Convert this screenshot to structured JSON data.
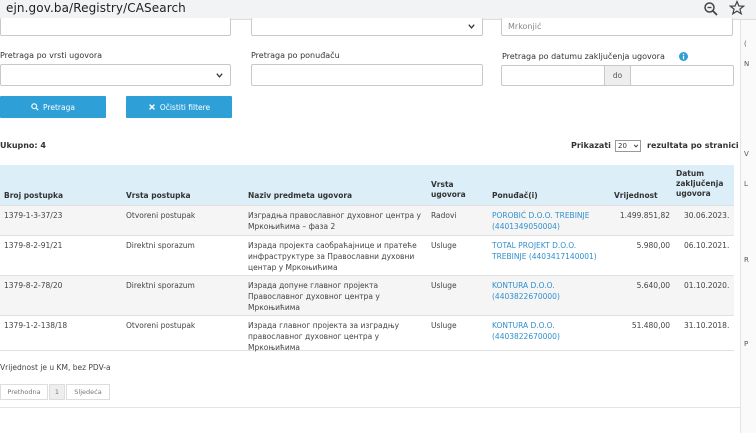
{
  "browser": {
    "url": "ejn.gov.ba/Registry/CASearch"
  },
  "filters": {
    "top_field_value": "Mrkonjić",
    "contract_type_label": "Pretraga po vrsti ugovora",
    "bidder_label": "Pretraga po ponuđaču",
    "date_label": "Pretraga po datumu zaključenja ugovora",
    "date_to_label": "do",
    "search_button": "Pretraga",
    "clear_button": "Očistiti filtere"
  },
  "results": {
    "total_label": "Ukupno: 4",
    "show_label": "Prikazati",
    "page_size": "20",
    "per_page_label": "rezultata po stranici"
  },
  "table": {
    "headers": {
      "number": "Broj postupka",
      "procedure_type": "Vrsta postupka",
      "subject": "Naziv predmeta ugovora",
      "contract_type": [
        "Vrsta",
        "ugovora"
      ],
      "bidder": "Ponuđač(i)",
      "value": "Vrijednost",
      "date": [
        "Datum",
        "zaključenja",
        "ugovora"
      ]
    },
    "rows": [
      {
        "number": "1379-1-3-37/23",
        "procedure_type": "Otvoreni postupak",
        "subject": [
          "Изградња православног духовног центра у",
          "Мркоњићима – фаза 2"
        ],
        "contract_type": "Radovi",
        "bidder": [
          "POROBIĆ D.O.O. TREBINJE",
          "(4401349050004)"
        ],
        "value": "1.499.851,82",
        "date": "30.06.2023."
      },
      {
        "number": "1379-8-2-91/21",
        "procedure_type": "Direktni sporazum",
        "subject": [
          "Израда пројекта саобраћајнице и прaтеће",
          "инфраструктуре за Православни духовни",
          "центар у Мркоњићима"
        ],
        "contract_type": "Usluge",
        "bidder": [
          "TOTAL PROJEKT D.O.O.",
          "TREBINJE (4403417140001)"
        ],
        "value": "5.980,00",
        "date": "06.10.2021."
      },
      {
        "number": "1379-8-2-78/20",
        "procedure_type": "Direktni sporazum",
        "subject": [
          "Израда допуне главног пројекта",
          "Православног духовног центра у",
          "Мркоњићима"
        ],
        "contract_type": "Usluge",
        "bidder": [
          "KONTURA D.O.O.",
          "(4403822670000)"
        ],
        "value": "5.640,00",
        "date": "01.10.2020."
      },
      {
        "number": "1379-1-2-138/18",
        "procedure_type": "Otvoreni postupak",
        "subject": [
          "Израда главног пројекта за изградњу",
          "православног духовног центра у",
          "Мркоњићима"
        ],
        "contract_type": "Usluge",
        "bidder": [
          "KONTURA D.O.O.",
          "(4403822670000)"
        ],
        "value": "51.480,00",
        "date": "31.10.2018."
      }
    ]
  },
  "footer": {
    "note": "Vrijednost je u KM, bez PDV-a",
    "prev": "Prethodna",
    "page": "1",
    "next": "Sljedeća"
  },
  "side_strip": {
    "chars": [
      "(",
      "N",
      "V",
      "L",
      "R",
      "P"
    ]
  },
  "colors": {
    "accent": "#2f9fd8",
    "header_bg": "#dceef7",
    "link": "#2f8fce"
  },
  "icons": {
    "zoom": "zoom-out-icon",
    "bookmark": "star-icon",
    "search": "search-icon",
    "clear": "x-icon",
    "info": "info-icon"
  }
}
